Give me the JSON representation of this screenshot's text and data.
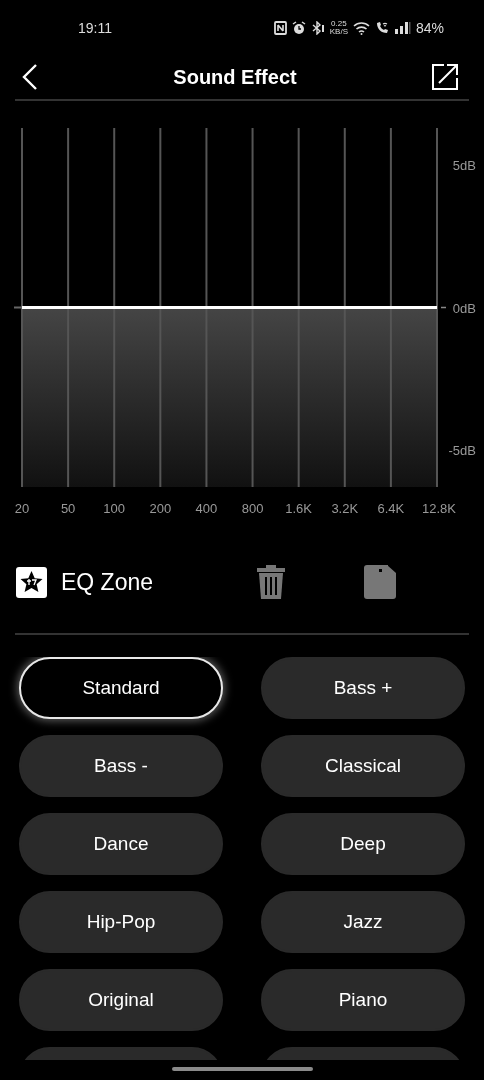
{
  "status_bar": {
    "time": "19:11",
    "net_speed": "0.25",
    "net_speed_unit": "KB/S",
    "battery": "84%"
  },
  "header": {
    "title": "Sound Effect"
  },
  "equalizer": {
    "chart_data": {
      "type": "line",
      "grid": true,
      "categories": [
        "20",
        "50",
        "100",
        "200",
        "400",
        "800",
        "1.6K",
        "3.2K",
        "6.4K",
        "12.8K"
      ],
      "values": [
        0,
        0,
        0,
        0,
        0,
        0,
        0,
        0,
        0,
        0
      ],
      "ylim": [
        -6.3,
        6.3
      ],
      "yticks": [
        {
          "value": 5,
          "label": "5dB"
        },
        {
          "value": 0,
          "label": "0dB"
        },
        {
          "value": -5,
          "label": "-5dB"
        }
      ]
    }
  },
  "eq_zone": {
    "label": "EQ Zone"
  },
  "presets": [
    {
      "kind": "preset",
      "label": "Standard",
      "selected": true
    },
    {
      "kind": "preset",
      "label": "Bass +",
      "selected": false
    },
    {
      "kind": "preset",
      "label": "Bass -",
      "selected": false
    },
    {
      "kind": "preset",
      "label": "Classical",
      "selected": false
    },
    {
      "kind": "preset",
      "label": "Dance",
      "selected": false
    },
    {
      "kind": "preset",
      "label": "Deep",
      "selected": false
    },
    {
      "kind": "preset",
      "label": "Hip-Pop",
      "selected": false
    },
    {
      "kind": "preset",
      "label": "Jazz",
      "selected": false
    },
    {
      "kind": "preset",
      "label": "Original",
      "selected": false
    },
    {
      "kind": "preset",
      "label": "Piano",
      "selected": false
    },
    {
      "kind": "cut"
    },
    {
      "kind": "cut"
    }
  ]
}
